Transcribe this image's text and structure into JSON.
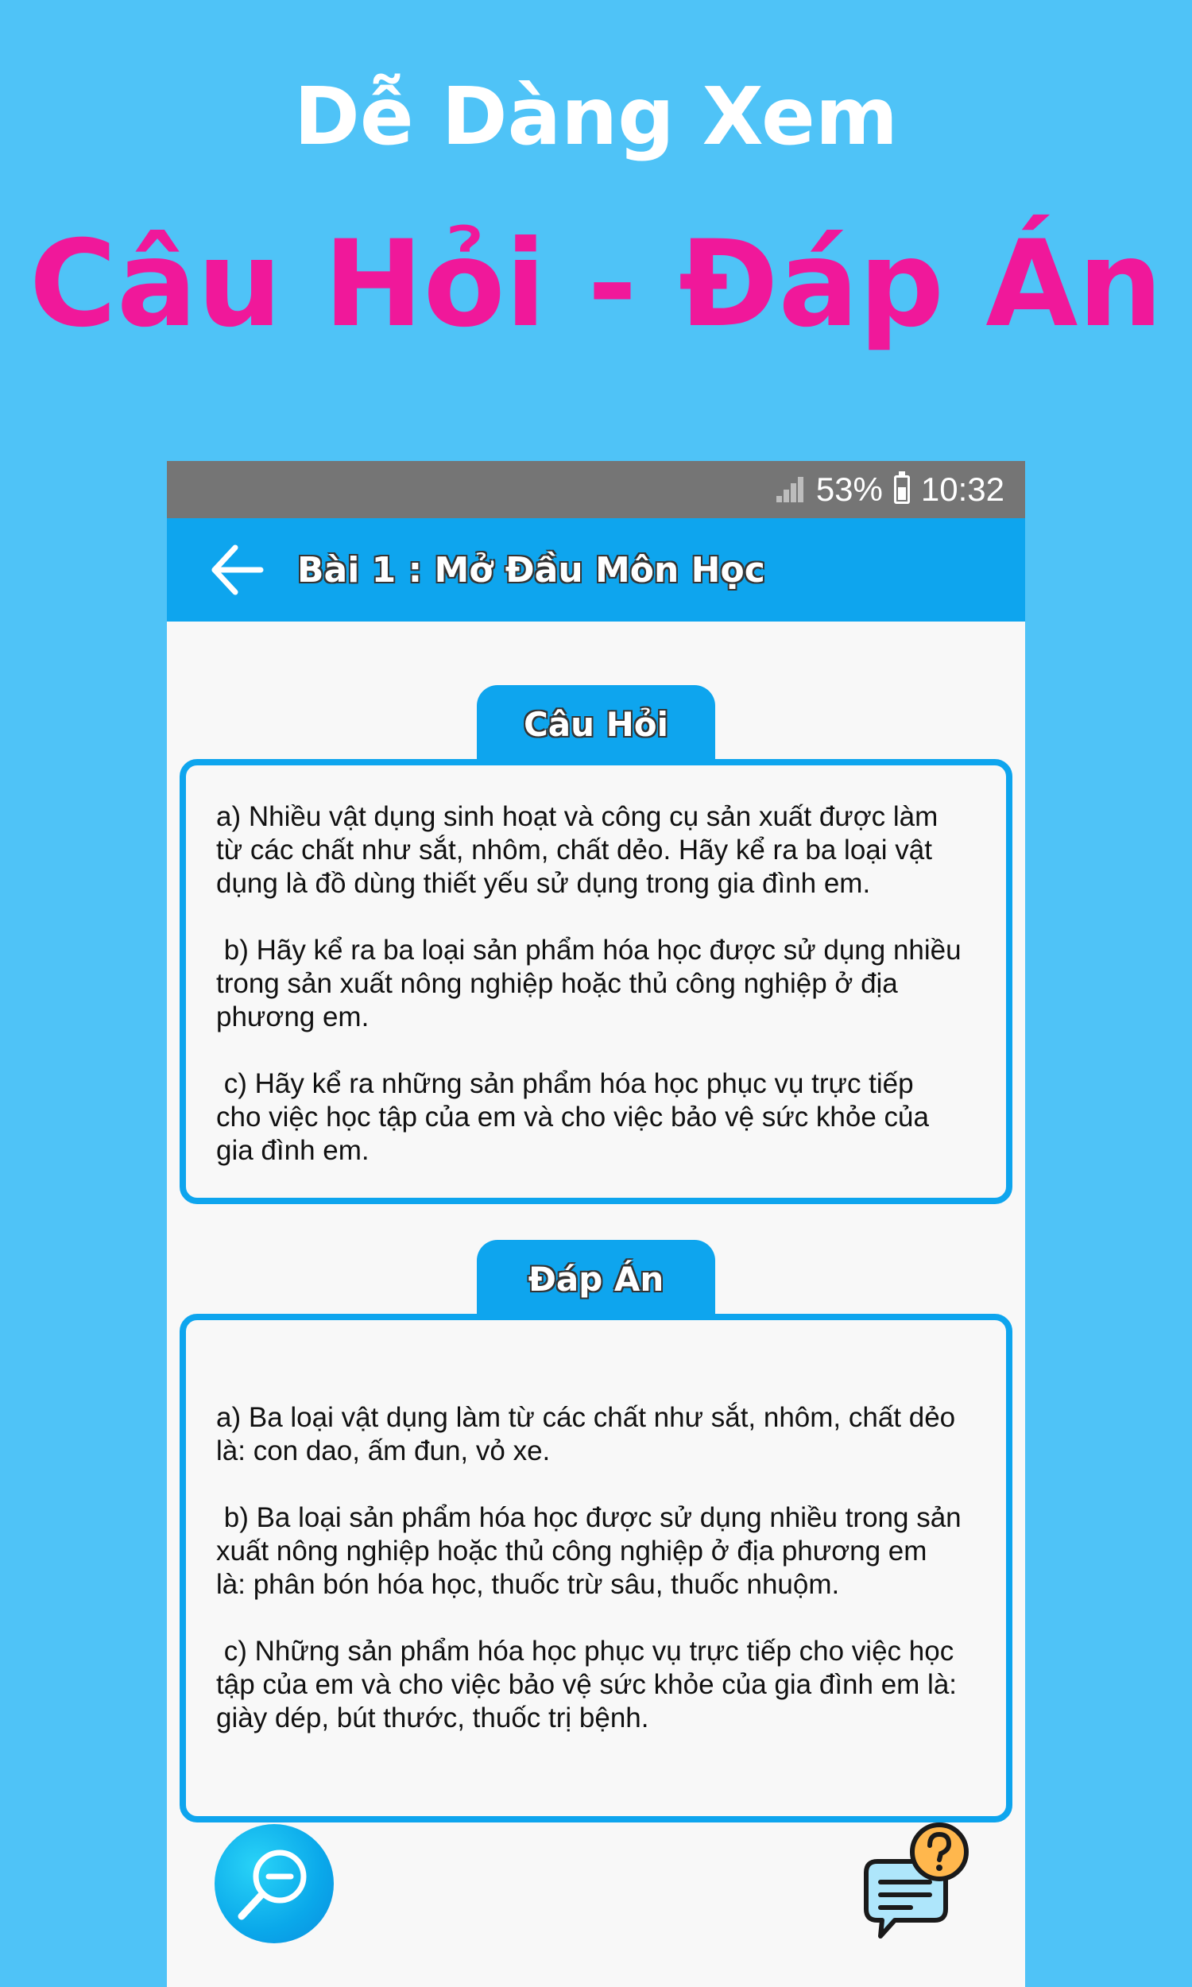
{
  "promo": {
    "subtitle": "Dễ Dàng Xem",
    "title": "Câu Hỏi - Đáp Án"
  },
  "status_bar": {
    "battery_percent": "53%",
    "time": "10:32",
    "icons": [
      "signal-icon",
      "battery-icon"
    ]
  },
  "app_bar": {
    "back_icon": "back-arrow-icon",
    "title": "Bài 1 : Mở Đầu Môn Học"
  },
  "question": {
    "tab_label": "Câu Hỏi",
    "paragraphs": [
      "a) Nhiều vật dụng sinh hoạt và công cụ sản xuất được làm\ntừ các chất như sắt, nhôm, chất dẻo. Hãy kể ra ba loại vật\ndụng là đồ dùng thiết yếu sử dụng trong gia đình em.",
      " b) Hãy kể ra ba loại sản phẩm hóa học được sử dụng nhiều\ntrong sản xuất nông nghiệp hoặc thủ công nghiệp ở địa\nphương em.",
      " c) Hãy kể ra những sản phẩm hóa học phục vụ trực tiếp\ncho việc học tập của em và cho việc bảo vệ sức khỏe của\ngia đình em."
    ]
  },
  "answer": {
    "tab_label": "Đáp Án",
    "paragraphs": [
      "a) Ba loại vật dụng làm từ các chất như sắt, nhôm, chất dẻo\nlà: con dao, ấm đun, vỏ xe.",
      " b) Ba loại sản phẩm hóa học được sử dụng nhiều trong sản\nxuất nông nghiệp hoặc thủ công nghiệp ở địa phương em\nlà: phân bón hóa học, thuốc trừ sâu, thuốc nhuộm.",
      " c) Những sản phẩm hóa học phục vụ trực tiếp cho việc học\ntập của em và cho việc bảo vệ sức khỏe của gia đình em là:\ngiày dép, bút thước, thuốc trị bệnh."
    ]
  },
  "floating": {
    "zoom_icon": "zoom-out-icon",
    "help_icon": "question-chat-icon"
  },
  "colors": {
    "background": "#4fc3f7",
    "accent": "#0ea5ee",
    "title_pink": "#f0189a",
    "status_bar": "#757575",
    "help_bubble": "#ffb74d"
  }
}
